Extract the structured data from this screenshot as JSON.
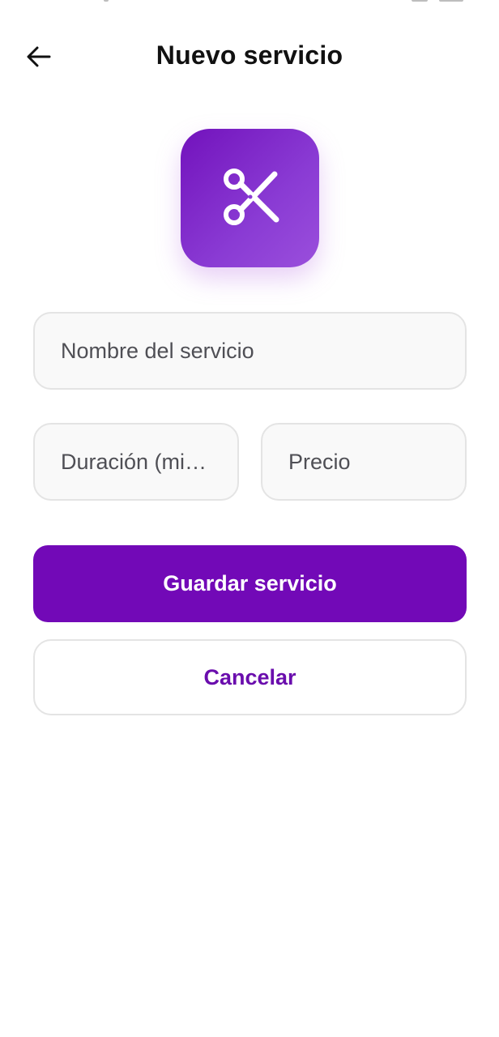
{
  "header": {
    "title": "Nuevo servicio"
  },
  "service_icon": {
    "icon": "scissors-icon",
    "gradient_start": "#7212bc",
    "gradient_end": "#9a4fdc"
  },
  "form": {
    "name_placeholder": "Nombre del servicio",
    "duration_placeholder": "Duración (minutos)",
    "price_placeholder": "Precio"
  },
  "actions": {
    "save_label": "Guardar servicio",
    "cancel_label": "Cancelar"
  },
  "colors": {
    "primary": "#7209b7",
    "cancel_text": "#6a0dad",
    "field_background": "#f9f9f9",
    "field_border": "#e4e4e4"
  }
}
